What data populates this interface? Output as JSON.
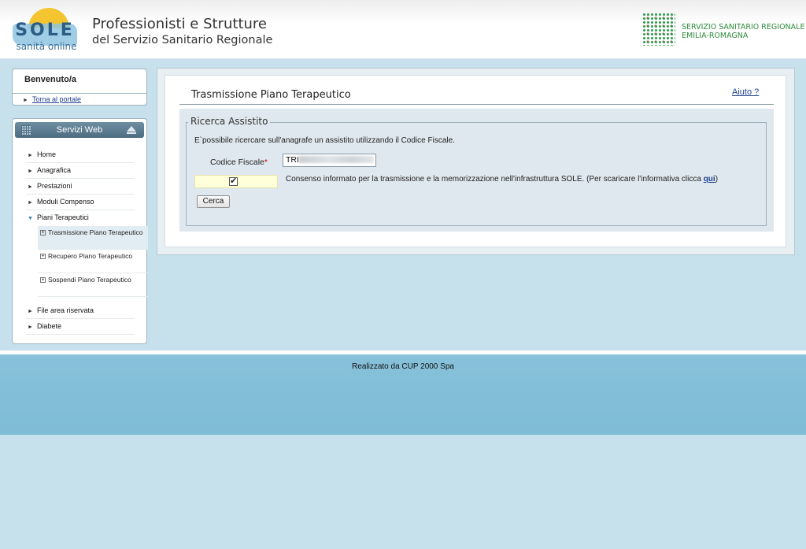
{
  "header": {
    "logo_text": "SOLE",
    "logo_sub": "sanità online",
    "title": "Professionisti e Strutture",
    "subtitle": "del Servizio Sanitario Regionale",
    "region_line1": "SERVIZIO SANITARIO REGIONALE",
    "region_line2": "EMILIA-ROMAGNA"
  },
  "welcome": {
    "title": "Benvenuto/a",
    "back_link": "Torna al portale"
  },
  "services": {
    "title": "Servizi Web",
    "items": [
      {
        "label": "Home"
      },
      {
        "label": "Anagrafica"
      },
      {
        "label": "Prestazioni"
      },
      {
        "label": "Moduli Compenso"
      },
      {
        "label": "Piani Terapeutici"
      },
      {
        "label": "File area riservata"
      },
      {
        "label": "Diabete"
      }
    ],
    "subitems": [
      {
        "label": "Trasmissione Piano Terapeutico"
      },
      {
        "label": "Recupero Piano Terapeutico"
      },
      {
        "label": "Sospendi Piano Terapeutico"
      }
    ]
  },
  "main": {
    "title": "Trasmissione Piano Terapeutico",
    "help": "Aiuto ?",
    "legend": "Ricerca Assistito",
    "description": "E`possibile ricercare sull'anagrafe un assistito utilizzando il Codice Fiscale.",
    "cf_label": "Codice Fiscale",
    "cf_required": "*",
    "cf_value": "TRI",
    "consent_text": "Consenso informato per la trasmissione e la memorizzazione nell'infrastruttura SOLE. (Per scaricare l'informativa clicca",
    "consent_link": "qui",
    "consent_close": ")",
    "consent_checked": "✔",
    "search_button": "Cerca"
  },
  "footer": {
    "text": "Realizzato da CUP 2000 Spa"
  }
}
